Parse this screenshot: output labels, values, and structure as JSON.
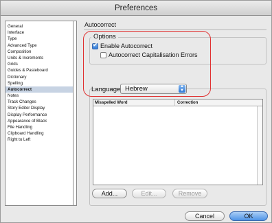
{
  "window": {
    "title": "Preferences"
  },
  "sidebar": {
    "items": [
      {
        "label": "General",
        "selected": false
      },
      {
        "label": "Interface",
        "selected": false
      },
      {
        "label": "Type",
        "selected": false
      },
      {
        "label": "Advanced Type",
        "selected": false
      },
      {
        "label": "Composition",
        "selected": false
      },
      {
        "label": "Units & Increments",
        "selected": false
      },
      {
        "label": "Grids",
        "selected": false
      },
      {
        "label": "Guides & Pasteboard",
        "selected": false
      },
      {
        "label": "Dictionary",
        "selected": false
      },
      {
        "label": "Spelling",
        "selected": false
      },
      {
        "label": "Autocorrect",
        "selected": true
      },
      {
        "label": "Notes",
        "selected": false
      },
      {
        "label": "Track Changes",
        "selected": false
      },
      {
        "label": "Story Editor Display",
        "selected": false
      },
      {
        "label": "Display Performance",
        "selected": false
      },
      {
        "label": "Appearance of Black",
        "selected": false
      },
      {
        "label": "File Handling",
        "selected": false
      },
      {
        "label": "Clipboard Handling",
        "selected": false
      },
      {
        "label": "Right to Left",
        "selected": false
      }
    ]
  },
  "panel": {
    "title": "Autocorrect",
    "options_legend": "Options",
    "enable_autocorrect": {
      "label": "Enable Autocorrect",
      "checked": true
    },
    "capitalisation_errors": {
      "label": "Autocorrect Capitalisation Errors",
      "checked": false
    },
    "language_label": "Language:",
    "language_value": "Hebrew",
    "table": {
      "columns": [
        "Misspelled Word",
        "Correction"
      ],
      "rows": []
    },
    "buttons": {
      "add": "Add...",
      "edit": "Edit...",
      "remove": "Remove"
    }
  },
  "footer": {
    "cancel": "Cancel",
    "ok": "OK"
  },
  "colors": {
    "highlight_outline": "#e03030",
    "selection": "#c7d3e3",
    "default_button": "#4f94e7"
  }
}
